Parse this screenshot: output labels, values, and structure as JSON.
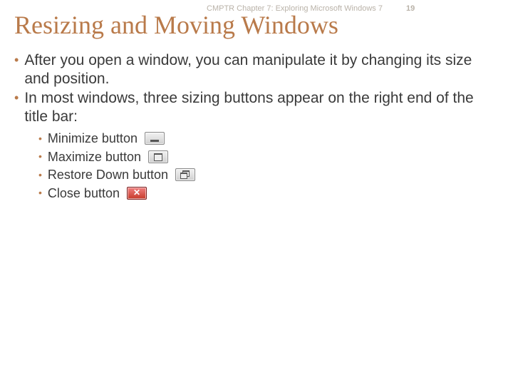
{
  "header": {
    "chapter": "CMPTR Chapter 7: Exploring Microsoft Windows 7",
    "page_number": "19"
  },
  "title": "Resizing and Moving Windows",
  "bullets": [
    "After you open a window, you can manipulate it by changing its size and position.",
    "In most windows, three sizing buttons appear on the right end of the title bar:"
  ],
  "subitems": [
    {
      "label": "Minimize button",
      "icon": "minimize"
    },
    {
      "label": "Maximize button",
      "icon": "maximize"
    },
    {
      "label": "Restore Down button",
      "icon": "restore"
    },
    {
      "label": "Close button",
      "icon": "close"
    }
  ]
}
